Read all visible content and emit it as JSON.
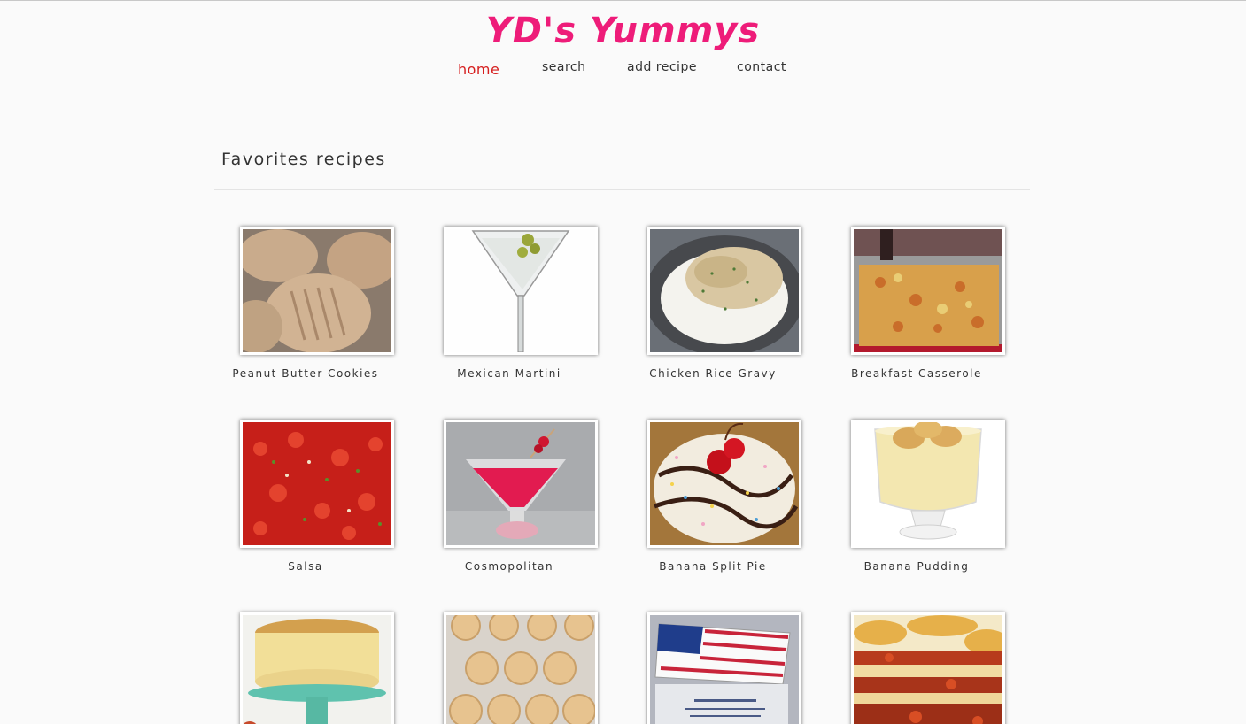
{
  "site": {
    "logo": "YD's Yummys"
  },
  "nav": [
    {
      "label": "home",
      "active": true
    },
    {
      "label": "search",
      "active": false
    },
    {
      "label": "add recipe",
      "active": false
    },
    {
      "label": "contact",
      "active": false
    }
  ],
  "favorites": {
    "title": "Favorites recipes",
    "recipes": [
      {
        "name": "Peanut Butter Cookies",
        "image": "peanut-butter-cookies-photo"
      },
      {
        "name": "Mexican Martini",
        "image": "martini-glass-photo"
      },
      {
        "name": "Chicken Rice Gravy",
        "image": "chicken-rice-plate-photo"
      },
      {
        "name": "Breakfast Casserole",
        "image": "casserole-pan-photo"
      },
      {
        "name": "Salsa",
        "image": "salsa-photo"
      },
      {
        "name": "Cosmopolitan",
        "image": "cosmopolitan-glass-photo"
      },
      {
        "name": "Banana Split Pie",
        "image": "banana-split-pie-photo"
      },
      {
        "name": "Banana Pudding",
        "image": "banana-pudding-cup-photo"
      },
      {
        "name": "",
        "image": "cheesecake-on-stand-photo"
      },
      {
        "name": "",
        "image": "cookies-on-tray-photo"
      },
      {
        "name": "",
        "image": "flag-cake-photo"
      },
      {
        "name": "",
        "image": "lasagna-photo"
      }
    ]
  }
}
